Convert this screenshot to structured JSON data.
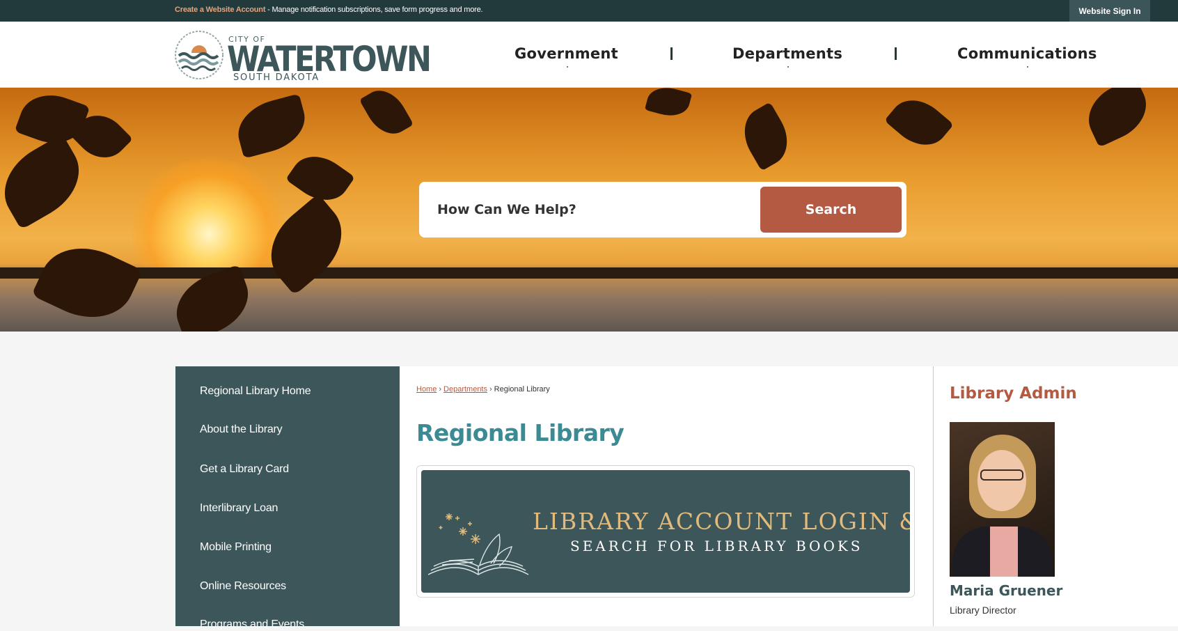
{
  "topbar": {
    "account_link": "Create a Website Account",
    "account_message": " - Manage notification subscriptions, save form progress and more.",
    "signin_label": "Website Sign In"
  },
  "logo": {
    "city_of": "CITY OF",
    "name": "WATERTOWN",
    "state": "SOUTH DAKOTA"
  },
  "nav": {
    "items": [
      "Government",
      "Departments",
      "Communications"
    ]
  },
  "search": {
    "placeholder": "How Can We Help?",
    "button_label": "Search"
  },
  "sidebar": {
    "items": [
      "Regional Library Home",
      "About the Library",
      "Get a Library Card",
      "Interlibrary Loan",
      "Mobile Printing",
      "Online Resources",
      "Programs and Events"
    ]
  },
  "breadcrumb": {
    "home": "Home",
    "departments": "Departments",
    "current": "Regional Library",
    "separator": "›"
  },
  "main": {
    "title": "Regional Library",
    "banner_line1": "LIBRARY ACCOUNT LOGIN &",
    "banner_line2": "SEARCH FOR LIBRARY BOOKS"
  },
  "admin": {
    "heading": "Library Admin",
    "name": "Maria Gruener",
    "role": "Library Director"
  },
  "colors": {
    "topbar": "#233a3d",
    "brand_teal": "#3c5659",
    "accent": "#b55a42",
    "title_teal": "#3c8a94",
    "banner_gold": "#e2bb7c"
  }
}
